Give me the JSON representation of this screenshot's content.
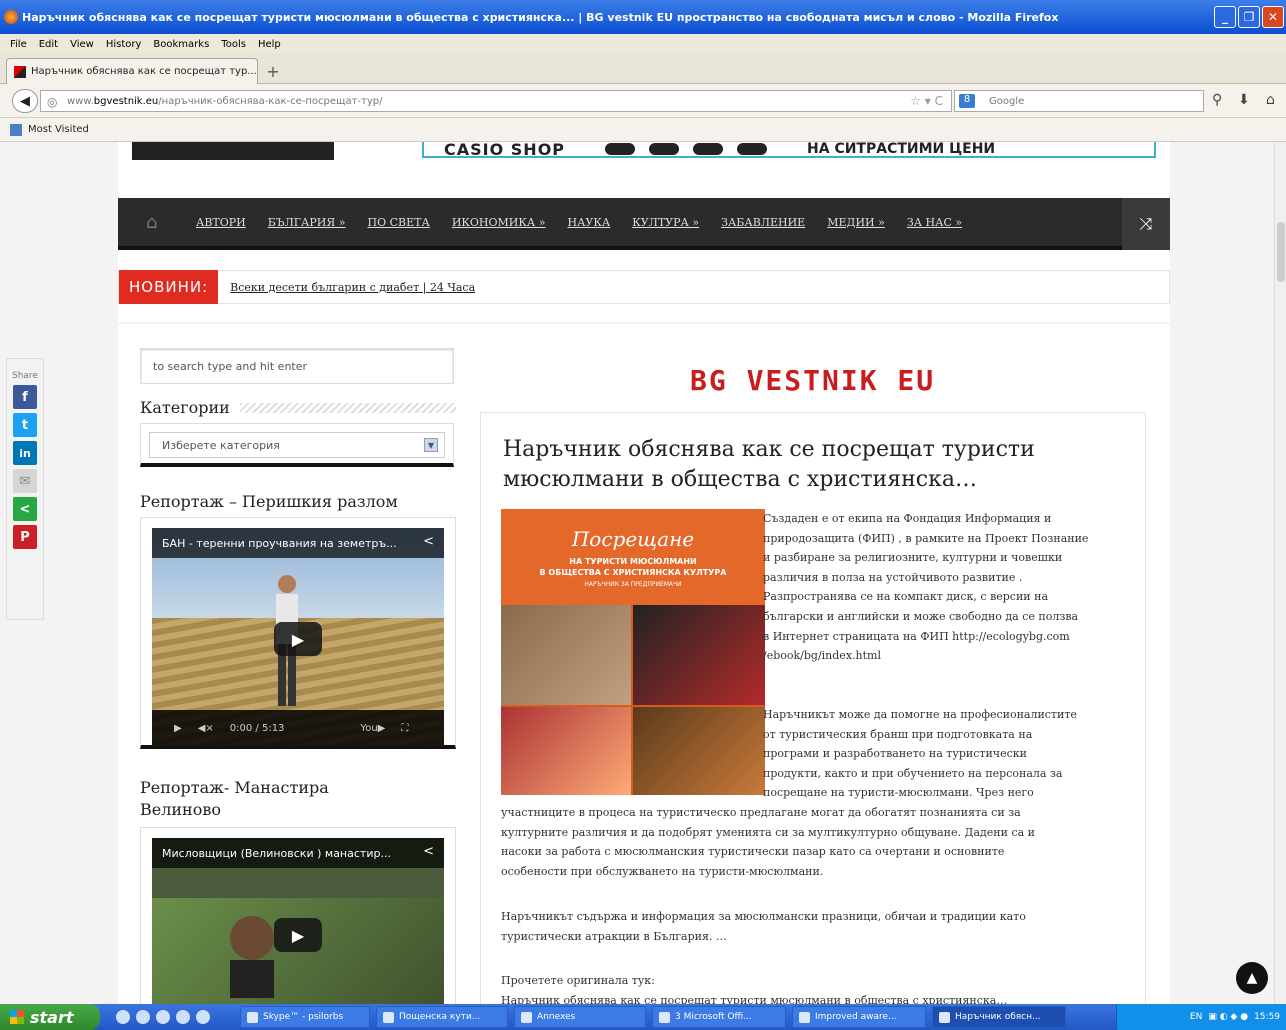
{
  "window": {
    "title": "Наръчник обяснява как се посрещат туристи мюсюлмани в общества с християнска... | BG vestnik EU пространство на свободната мисъл и слово - Mozilla Firefox"
  },
  "menu": [
    "File",
    "Edit",
    "View",
    "History",
    "Bookmarks",
    "Tools",
    "Help"
  ],
  "tab": {
    "label": "Наръчник обяснява как се посрещат тур...",
    "new": "+"
  },
  "address": {
    "prefix": "www.",
    "domain": "bgvestnik.eu",
    "path": "/наръчник-обяснява-как-се-посрещат-тур/"
  },
  "search": {
    "placeholder": "Google"
  },
  "bookmarks": {
    "most_visited": "Most Visited"
  },
  "banner": {
    "ad_text": "CASIO SHOP",
    "ad_right": "НА СИТРАСТИМИ ЦЕНИ"
  },
  "nav": {
    "items": [
      "АВТОРИ",
      "БЪЛГАРИЯ »",
      "ПО СВЕТА",
      "ИКОНОМИКА »",
      "НАУКА",
      "КУЛТУРА »",
      "ЗАБАВЛЕНИЕ",
      "МЕДИИ »",
      "ЗА НАС »"
    ]
  },
  "news": {
    "label": "НОВИНИ:",
    "headline": "Всеки десети българин с диабет | 24 Часа"
  },
  "sidebar": {
    "search_placeholder": "to search type and hit enter",
    "categories_title": "Категории",
    "categories_select": "Изберете категория",
    "video1_title": "Репортаж – Перишкия разлом",
    "video1_caption": "БАН - теренни проучвания на земетръ...",
    "video1_time": "0:00 / 5:13",
    "video2_title": "Репортаж- Манастира Велиново",
    "video2_caption": "Мисловщици (Велиновски ) манастир..."
  },
  "share": {
    "label": "Share",
    "buttons": [
      "f",
      "t",
      "in",
      "✉",
      "<",
      "P"
    ]
  },
  "logo": "BG VESTNIK EU",
  "article": {
    "title_line1": "Наръчник обяснява как се посрещат туристи",
    "title_line2": "мюсюлмани в общества с християнска…",
    "image_title": "Посрещане",
    "image_sub1": "НА ТУРИСТИ МЮСЮЛМАНИ",
    "image_sub2": "В ОБЩЕСТВА С ХРИСТИЯНСКА КУЛТУРА",
    "image_sub3": "НАРЪЧНИК ЗА ПРЕДПРИЕМАЧИ",
    "p1": [
      "Създаден е от екипа на Фондация Информация и",
      "природозащита (ФИП) , в рамките на Проект Познание",
      "и разбиране за религиозните, културни и човешки",
      "различия в полза на устойчивото развитие .",
      "Разпространява се на компакт диск, с версии на",
      "български и английски и може свободно да се ползва",
      "в Интернет страницата на ФИП http://ecologybg.com",
      "/ebook/bg/index.html"
    ],
    "p2": [
      "Наръчникът може да помогне на професионалистите",
      "от туристическия бранш при подготовката на",
      "програми и разработването на туристически",
      "продукти, както и при обучението на персонала за",
      "посрещане на туристи-мюсюлмани. Чрез него"
    ],
    "p2_full": [
      "участниците в процеса на туристическо предлагане могат да обогатят познанията си за",
      "културните различия и да подобрят уменията си за мултикултурно общуване. Дадени са и",
      "насоки за работа с мюсюлманския туристически пазар като са очертани и основните",
      "особености при обслужването на туристи-мюсюлмани."
    ],
    "p3": [
      "Наръчникът съдържа и информация за мюсюлмански празници, обичаи и традиции като",
      "туристически атракции в България. …"
    ],
    "read_more_label": "Прочетете оригинала тук:",
    "read_more_link": "Наръчник обяснява как се посрещат туристи мюсюлмани в общества с християнска…"
  },
  "taskbar": {
    "start": "start",
    "items": [
      "Skype™ - psilorbs",
      "Пощенска кути...",
      "Annexes",
      "3 Microsoft Offi...",
      "Improved aware...",
      "Наръчник обясн..."
    ],
    "lang": "EN",
    "clock": "15:59"
  }
}
